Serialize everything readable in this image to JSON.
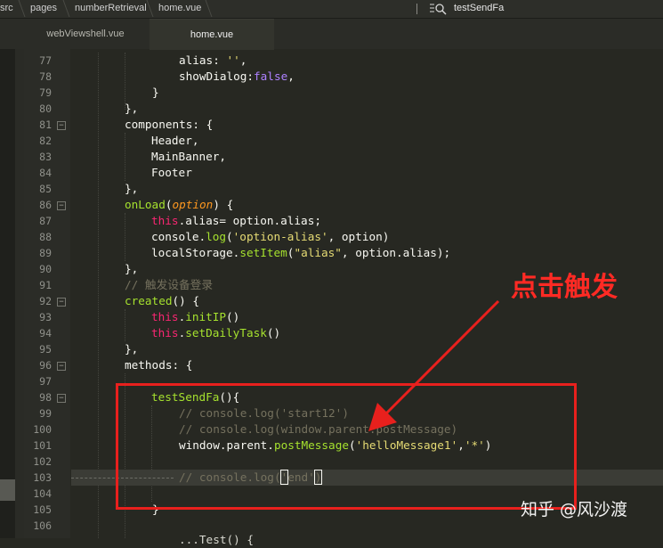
{
  "breadcrumb": [
    "src",
    "pages",
    "numberRetrieval",
    "home.vue"
  ],
  "symbol_search": {
    "value": "testSendFa",
    "icon": "symbol-search-icon"
  },
  "tabs": [
    {
      "label": "webViewshell.vue",
      "active": false
    },
    {
      "label": "home.vue",
      "active": true
    }
  ],
  "line_numbers": [
    "77",
    "78",
    "79",
    "80",
    "81",
    "82",
    "83",
    "84",
    "85",
    "86",
    "87",
    "88",
    "89",
    "90",
    "91",
    "92",
    "93",
    "94",
    "95",
    "96",
    "97",
    "98",
    "99",
    "100",
    "101",
    "102",
    "103",
    "104",
    "105",
    "106"
  ],
  "code": {
    "l77": {
      "text": "alias: '',",
      "parts": [
        "alias: ",
        "''",
        ","
      ]
    },
    "l78": {
      "parts": [
        "showDialog:",
        "false",
        ","
      ]
    },
    "l79": "}",
    "l80": "},",
    "l81": "components: {",
    "l82": "Header,",
    "l83": "MainBanner,",
    "l84": "Footer",
    "l85": "},",
    "l86": {
      "parts": [
        "onLoad",
        "(",
        "option",
        ") {"
      ]
    },
    "l87": {
      "parts": [
        "this",
        ".alias= option.alias;"
      ]
    },
    "l88": {
      "parts": [
        "console.",
        "log",
        "(",
        "'option-alias'",
        ", option)"
      ]
    },
    "l89": {
      "parts": [
        "localStorage.",
        "setItem",
        "(",
        "\"alias\"",
        ", option.alias);"
      ]
    },
    "l90": "},",
    "l91": "// 触发设备登录",
    "l92": {
      "parts": [
        "created",
        "() {"
      ]
    },
    "l93": {
      "parts": [
        "this",
        ".",
        "initIP",
        "()"
      ]
    },
    "l94": {
      "parts": [
        "this",
        ".",
        "setDailyTask",
        "()"
      ]
    },
    "l95": "},",
    "l96": "methods: {",
    "l98": {
      "parts": [
        "testSendFa",
        "(){"
      ]
    },
    "l99": "// console.log('start12')",
    "l100": "// console.log(window.parent.postMessage)",
    "l101": {
      "parts": [
        "window.parent.",
        "postMessage",
        "(",
        "'helloMessage1'",
        ",",
        "'*'",
        ")"
      ]
    },
    "l103": {
      "parts": [
        "// console.log(",
        "'",
        "end",
        "'",
        ")"
      ]
    },
    "l105": "}",
    "l107": "...Test() {"
  },
  "annotation": {
    "text": "点击触发",
    "color": "#ff2a24"
  },
  "watermark": "知乎 @风沙渡",
  "colors": {
    "background": "#272822",
    "string": "#e6db74",
    "keyword": "#f92672",
    "function": "#a6e22e",
    "constant": "#ae81ff",
    "comment": "#75715e",
    "annotation_red": "#e8201d"
  }
}
